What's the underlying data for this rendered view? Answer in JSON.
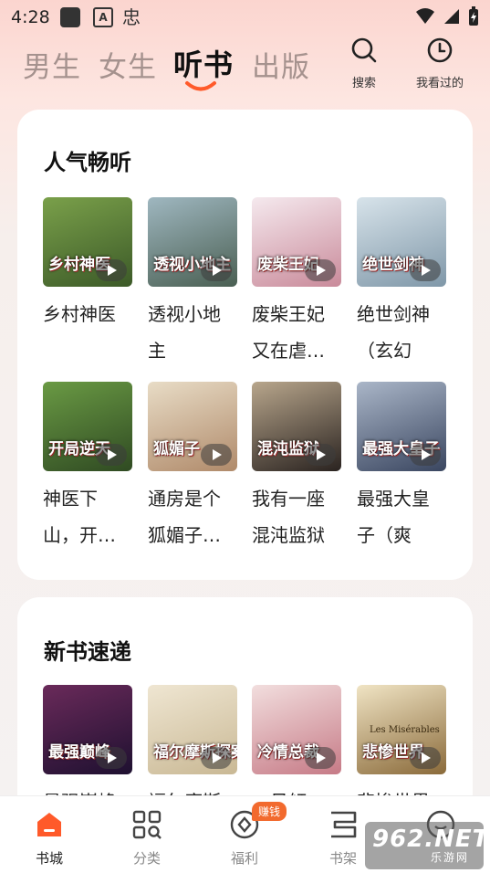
{
  "status_bar": {
    "time": "4:28",
    "app_icon_letter": "A",
    "app_icon_glyph": "忠"
  },
  "top_nav": {
    "tabs": [
      {
        "label": "男生",
        "active": false
      },
      {
        "label": "女生",
        "active": false
      },
      {
        "label": "听书",
        "active": true
      },
      {
        "label": "出版",
        "active": false
      }
    ],
    "search_label": "搜索",
    "history_label": "我看过的"
  },
  "sections": [
    {
      "title": "人气畅听",
      "books": [
        {
          "title": "乡村神医",
          "cover_text": "乡村神医",
          "cover_colors": [
            "#7aa04a",
            "#3c5a28"
          ]
        },
        {
          "title": "透视小地主",
          "cover_text": "透视小地主",
          "cover_colors": [
            "#9fb7c0",
            "#4a5f52"
          ]
        },
        {
          "title": "废柴王妃又在虐…",
          "cover_text": "废柴王妃",
          "cover_colors": [
            "#f5e9ee",
            "#c98a9a"
          ]
        },
        {
          "title": "绝世剑神（玄幻热…",
          "cover_text": "绝世剑神",
          "cover_colors": [
            "#d7e3ea",
            "#7f97a8"
          ]
        },
        {
          "title": "神医下山，开…",
          "cover_text": "开局逆天",
          "cover_colors": [
            "#6a9a44",
            "#2f4a22"
          ]
        },
        {
          "title": "通房是个狐媚子…",
          "cover_text": "狐媚子",
          "cover_colors": [
            "#e8dcc6",
            "#b08a6a"
          ]
        },
        {
          "title": "我有一座混沌监狱",
          "cover_text": "混沌监狱",
          "cover_colors": [
            "#b8a68c",
            "#2a2320"
          ]
        },
        {
          "title": "最强大皇子（爽文…",
          "cover_text": "最强大皇子",
          "cover_colors": [
            "#aab6c8",
            "#3a4660"
          ]
        }
      ]
    },
    {
      "title": "新书速递",
      "books": [
        {
          "title": "最强巅峰",
          "cover_text": "最强巅峰",
          "cover_colors": [
            "#6a2a5a",
            "#1e1030"
          ]
        },
        {
          "title": "福尔摩斯探案集",
          "cover_text": "福尔摩斯探案集",
          "cover_colors": [
            "#efe6d2",
            "#c9b894"
          ]
        },
        {
          "title": "一见倾心，冷情总裁",
          "cover_text": "冷情总裁",
          "cover_colors": [
            "#f2dede",
            "#c67a86"
          ]
        },
        {
          "title": "悲惨世界",
          "cover_text": "悲惨世界",
          "subtitle": "Les Misérables",
          "cover_colors": [
            "#f0e4c4",
            "#8a6a3a"
          ]
        }
      ]
    }
  ],
  "bottom_nav": {
    "items": [
      {
        "label": "书城",
        "icon": "home-icon",
        "active": true
      },
      {
        "label": "分类",
        "icon": "grid-icon",
        "active": false
      },
      {
        "label": "福利",
        "icon": "coin-icon",
        "active": false
      },
      {
        "label": "书架",
        "icon": "shelf-icon",
        "active": false
      },
      {
        "label": "",
        "icon": "profile-icon",
        "active": false
      }
    ],
    "badge": "赚钱"
  },
  "watermark": {
    "main": "962.NET",
    "sub": "乐游网"
  },
  "colors": {
    "accent": "#ff5a2a",
    "badge": "#f26a2e"
  }
}
